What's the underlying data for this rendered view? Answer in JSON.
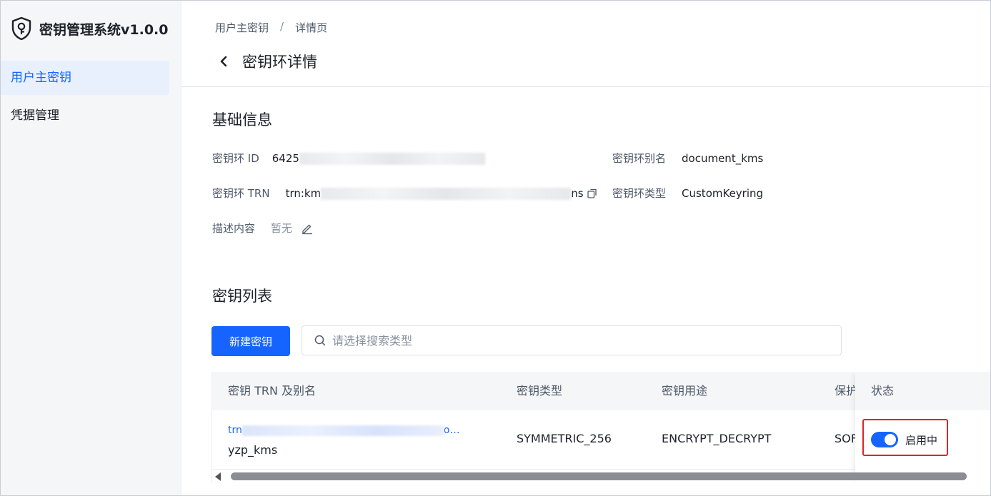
{
  "app": {
    "title": "密钥管理系统v1.0.0",
    "icon": "shield-key-icon"
  },
  "sidebar": {
    "items": [
      {
        "label": "用户主密钥",
        "active": true
      },
      {
        "label": "凭据管理",
        "active": false
      }
    ]
  },
  "header": {
    "breadcrumb": [
      "用户主密钥",
      "详情页"
    ],
    "breadcrumb_sep": "/",
    "title": "密钥环详情"
  },
  "basic_info": {
    "title": "基础信息",
    "keyring_id": {
      "label": "密钥环 ID",
      "value_prefix": "6425"
    },
    "keyring_alias": {
      "label": "密钥环别名",
      "value": "document_kms"
    },
    "keyring_trn": {
      "label": "密钥环 TRN",
      "value_prefix": "trn:km",
      "value_suffix": "ns"
    },
    "keyring_type": {
      "label": "密钥环类型",
      "value": "CustomKeyring"
    },
    "description": {
      "label": "描述内容",
      "value": "暂无"
    }
  },
  "key_list": {
    "title": "密钥列表",
    "new_button": "新建密钥",
    "search_placeholder": "请选择搜索类型",
    "columns": [
      "密钥 TRN 及别名",
      "密钥类型",
      "密钥用途",
      "保护",
      "状态"
    ],
    "rows": [
      {
        "trn_prefix": "trn",
        "trn_suffix": "o…",
        "alias": "yzp_kms",
        "key_type": "SYMMETRIC_256",
        "usage": "ENCRYPT_DECRYPT",
        "protection": "SOF",
        "status": "启用中",
        "enabled": true
      }
    ]
  },
  "colors": {
    "accent": "#1664ff",
    "highlight": "#e02424",
    "sidebar_bg": "#f5f6f8"
  }
}
